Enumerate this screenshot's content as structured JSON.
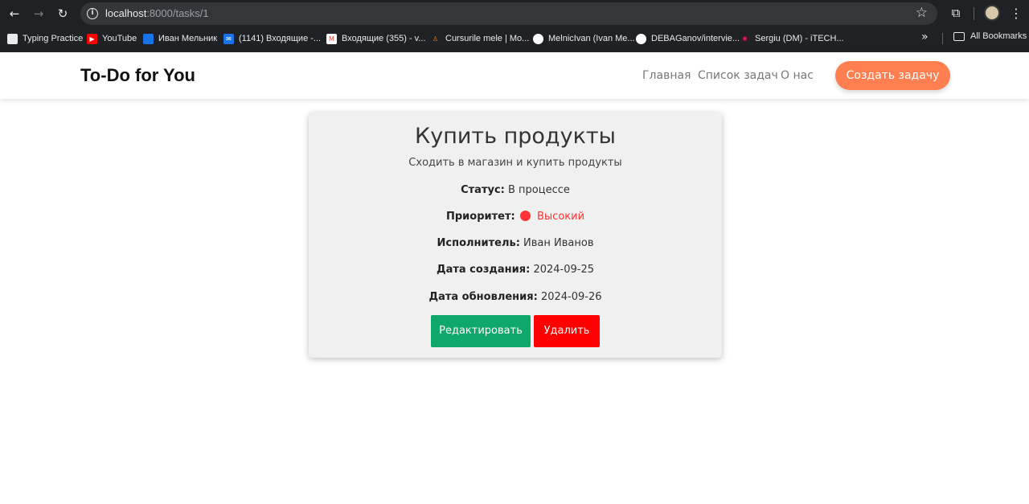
{
  "browser": {
    "url_host": "localhost",
    "url_path": ":8000/tasks/1",
    "bookmarks": [
      {
        "label": "Typing Practice",
        "icon": "page-icon",
        "color": "#e8eaed"
      },
      {
        "label": "YouTube",
        "icon": "youtube-icon",
        "color": "#ff0000"
      },
      {
        "label": "Иван Мельник",
        "icon": "chat-icon",
        "color": "#1a73e8"
      },
      {
        "label": "(1141) Входящие -...",
        "icon": "mail-icon",
        "color": "#1a73e8"
      },
      {
        "label": "Входящие (355) - v...",
        "icon": "gmail-icon",
        "color": "#ea4335"
      },
      {
        "label": "Cursurile mele | Mo...",
        "icon": "moodle-icon",
        "color": "#f98012"
      },
      {
        "label": "MelnicIvan (Ivan Me...",
        "icon": "github-icon",
        "color": "#ffffff"
      },
      {
        "label": "DEBAGanov/intervie...",
        "icon": "github-icon",
        "color": "#ffffff"
      },
      {
        "label": "Sergiu (DM) - iTECH...",
        "icon": "slack-icon",
        "color": "#e01e5a"
      }
    ],
    "more_label": "»",
    "all_bookmarks": "All Bookmarks"
  },
  "site": {
    "brand": "To-Do for You",
    "nav": [
      "Главная",
      "Список задач",
      "О нас"
    ],
    "cta": "Создать задачу",
    "accent": "#ff7f50"
  },
  "task": {
    "title": "Купить продукты",
    "description": "Сходить в магазин и купить продукты",
    "status_label": "Статус:",
    "status_value": "В процессе",
    "priority_label": "Приоритет:",
    "priority_value": "Высокий",
    "priority_color": "#ff3333",
    "assignee_label": "Исполнитель:",
    "assignee_value": "Иван Иванов",
    "created_label": "Дата создания:",
    "created_value": "2024-09-25",
    "updated_label": "Дата обновления:",
    "updated_value": "2024-09-26",
    "edit_label": "Редактировать",
    "delete_label": "Удалить"
  }
}
